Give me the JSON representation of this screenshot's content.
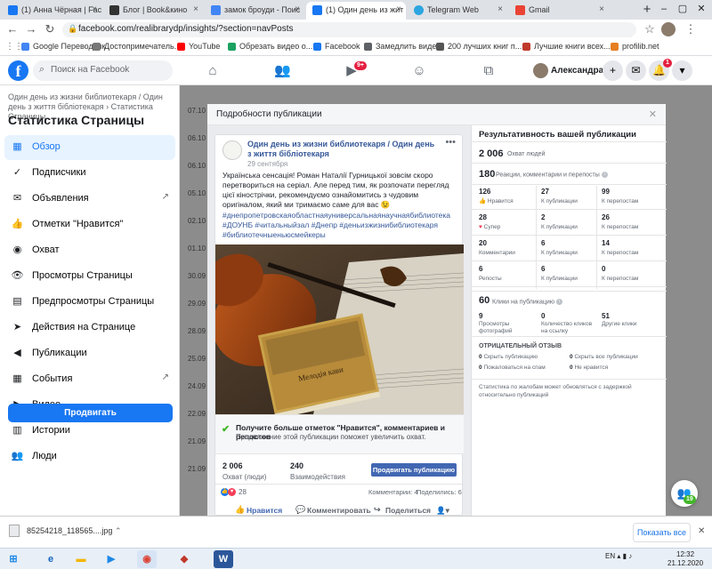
{
  "browser": {
    "tabs": [
      {
        "label": "(1) Анна Чёрная | Fac",
        "color": "#1877f2"
      },
      {
        "label": "Блог | Book&кино",
        "color": "#333333"
      },
      {
        "label": "замок броуди - Поис",
        "color": "#4285f4"
      },
      {
        "label": "(1) Один день из жит",
        "color": "#1877f2"
      },
      {
        "label": "Telegram Web",
        "color": "#2ca5e0"
      },
      {
        "label": "Gmail",
        "color": "#ea4335"
      }
    ],
    "new_tab": "+",
    "url": "facebook.com/realibrarydp/insights/?section=navPosts",
    "bookmarks": [
      {
        "label": "Google Переводчик",
        "color": "#4285f4"
      },
      {
        "label": "Достопримечатель...",
        "color": "#777777"
      },
      {
        "label": "YouTube",
        "color": "#ff0000"
      },
      {
        "label": "Обрезать видео о...",
        "color": "#1aa260"
      },
      {
        "label": "Facebook",
        "color": "#1877f2"
      },
      {
        "label": "Замедлить видео",
        "color": "#5f6368"
      },
      {
        "label": "200 лучших книг п...",
        "color": "#555555"
      },
      {
        "label": "Лучшие книги всех...",
        "color": "#c0392b"
      },
      {
        "label": "profilib.net",
        "color": "#e67e22"
      }
    ]
  },
  "fb": {
    "search_placeholder": "Поиск на Facebook",
    "watch_badge": "9+",
    "notif_badge": "1",
    "user_name": "Александра"
  },
  "sidebar": {
    "breadcrumb": "Один день из жизни библиотекаря / Один день з життя бібліотекаря › Статистика Страницы",
    "title": "Статистика Страницы",
    "items": [
      {
        "label": "Обзор",
        "icon": "▦"
      },
      {
        "label": "Подписчики",
        "icon": "✓"
      },
      {
        "label": "Объявления",
        "icon": "✉"
      },
      {
        "label": "Отметки \"Нравится\"",
        "icon": "👍"
      },
      {
        "label": "Охват",
        "icon": "◉"
      },
      {
        "label": "Просмотры Страницы",
        "icon": "👁"
      },
      {
        "label": "Предпросмотры Страницы",
        "icon": "▤"
      },
      {
        "label": "Действия на Странице",
        "icon": "➤"
      },
      {
        "label": "Публикации",
        "icon": "◀"
      },
      {
        "label": "События",
        "icon": "▦"
      },
      {
        "label": "Видео",
        "icon": "▶"
      },
      {
        "label": "Истории",
        "icon": "▥"
      },
      {
        "label": "Люди",
        "icon": "👥"
      }
    ],
    "promote_label": "Продвигать"
  },
  "background_dates": [
    "07.10",
    "06.10",
    "06.10",
    "05.10",
    "02.10",
    "01.10",
    "30.09",
    "29.09",
    "28.09",
    "25.09",
    "24.09",
    "22.09",
    "21.09",
    "21.09"
  ],
  "modal": {
    "title": "Подробности публикации",
    "post": {
      "page_name": "Один день из жизни библиотекаря / Один день з життя бібліотекаря",
      "date": "29 сентября",
      "text": "Українська сенсація! Роман Наталії Гурницької зовсім скоро перетвориться на серіал. Але перед тим, як розпочати перегляд цієї кінострічки, рекомендуємо ознайомитись з чудовим оригіналом, який ми тримаємо саме для вас 😉",
      "hashtags": "#днепропетровскаяобластнаяуниверсальнаянаучнаябиблиотека #ДОУНБ #читальныйзал #Днепр #деньизжизнибиблиотекаря #библиотечныеньюсмейкеры",
      "book_title": "Мелодія кави",
      "promo_title": "Получите больше отметок \"Нравится\", комментариев и репостов",
      "promo_sub": "Продвижение этой публикации поможет увеличить охват.",
      "reach_num": "2 006",
      "reach_label": "Охват (люди)",
      "inter_num": "240",
      "inter_label": "Взаимодействия",
      "boost_label": "Продвигать публикацию",
      "reactions": "28",
      "comments": "Комментарии: 4",
      "shares": "Поделились: 6",
      "act_like": "Нравится",
      "act_comment": "Комментировать",
      "act_share": "Поделиться"
    },
    "perf": {
      "title": "Результативность вашей публикации",
      "reach_num": "2 006",
      "reach_label": "Охват людей",
      "eng_num": "180",
      "eng_label": "Реакции, комментарии и перепосты",
      "rows": [
        {
          "a": "126",
          "al": "Нравится",
          "b": "27",
          "bl": "К публикации",
          "c": "99",
          "cl": "К перепостам"
        },
        {
          "a": "28",
          "al": "Супер",
          "b": "2",
          "bl": "К публикации",
          "c": "26",
          "cl": "К перепостам"
        },
        {
          "a": "20",
          "al": "Комментарии",
          "b": "6",
          "bl": "К публикации",
          "c": "14",
          "cl": "К перепостам"
        },
        {
          "a": "6",
          "al": "Репосты",
          "b": "6",
          "bl": "К публикации",
          "c": "0",
          "cl": "К перепостам"
        }
      ],
      "clicks_num": "60",
      "clicks_label": "Клики на публикацию",
      "clicks": [
        {
          "n": "9",
          "l": "Просмотры фотографий"
        },
        {
          "n": "0",
          "l": "Количество кликов на ссылку"
        },
        {
          "n": "51",
          "l": "Другие клики"
        }
      ],
      "neg_title": "ОТРИЦАТЕЛЬНЫЙ ОТЗЫВ",
      "neg": [
        {
          "n": "0",
          "l": "Скрыть публикацию"
        },
        {
          "n": "0",
          "l": "Скрыть все публикации"
        },
        {
          "n": "0",
          "l": "Пожаловаться на спам"
        },
        {
          "n": "0",
          "l": "Не нравится"
        }
      ],
      "footnote": "Статистика по жалобам может обновляться с задержкой относительно публикаций"
    }
  },
  "chat_count": "19",
  "download": {
    "file": "85254218_118565....jpg",
    "show_all": "Показать все"
  },
  "taskbar": {
    "lang": "EN",
    "time": "12:32",
    "date": "21.12.2020"
  }
}
